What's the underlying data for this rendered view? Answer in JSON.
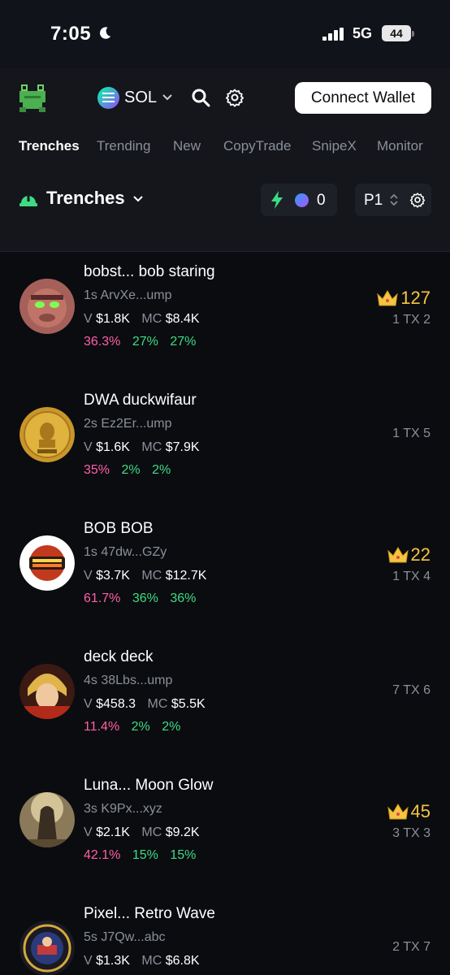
{
  "status": {
    "time": "7:05",
    "network": "5G",
    "battery": "44"
  },
  "header": {
    "chain": "SOL",
    "connect_label": "Connect Wallet"
  },
  "tabs": [
    "Trenches",
    "Trending",
    "New",
    "CopyTrade",
    "SnipeX",
    "Monitor"
  ],
  "section": {
    "title": "Trenches",
    "filter_count": "0",
    "page": "P1"
  },
  "colors": {
    "accent_green": "#3ddc84",
    "accent_pink": "#ff5fa8",
    "crown_gold": "#f5c542",
    "background": "#0b0c10"
  },
  "tokens": [
    {
      "name": "bobst... bob staring",
      "meta": "1s ArvXe...ump",
      "v_label": "V",
      "volume": "$1.8K",
      "mc_label": "MC",
      "mc": "$8.4K",
      "p1": "36.3%",
      "p2": "27%",
      "p3": "27%",
      "crown": "127",
      "tx": "1 TX 2"
    },
    {
      "name": "DWA duckwifaur",
      "meta": "2s Ez2Er...ump",
      "v_label": "V",
      "volume": "$1.6K",
      "mc_label": "MC",
      "mc": "$7.9K",
      "p1": "35%",
      "p2": "2%",
      "p3": "2%",
      "crown": "",
      "tx": "1 TX 5"
    },
    {
      "name": "BOB BOB",
      "meta": "1s 47dw...GZy",
      "v_label": "V",
      "volume": "$3.7K",
      "mc_label": "MC",
      "mc": "$12.7K",
      "p1": "61.7%",
      "p2": "36%",
      "p3": "36%",
      "crown": "22",
      "tx": "1 TX 4"
    },
    {
      "name": "deck deck",
      "meta": "4s 38Lbs...ump",
      "v_label": "V",
      "volume": "$458.3",
      "mc_label": "MC",
      "mc": "$5.5K",
      "p1": "11.4%",
      "p2": "2%",
      "p3": "2%",
      "crown": "",
      "tx": "7 TX 6"
    },
    {
      "name": "Luna... Moon Glow",
      "meta": "3s K9Px...xyz",
      "v_label": "V",
      "volume": "$2.1K",
      "mc_label": "MC",
      "mc": "$9.2K",
      "p1": "42.1%",
      "p2": "15%",
      "p3": "15%",
      "crown": "45",
      "tx": "3 TX 3"
    },
    {
      "name": "Pixel... Retro Wave",
      "meta": "5s J7Qw...abc",
      "v_label": "V",
      "volume": "$1.3K",
      "mc_label": "MC",
      "mc": "$6.8K",
      "p1": "",
      "p2": "",
      "p3": "",
      "crown": "",
      "tx": "2 TX 7"
    }
  ]
}
